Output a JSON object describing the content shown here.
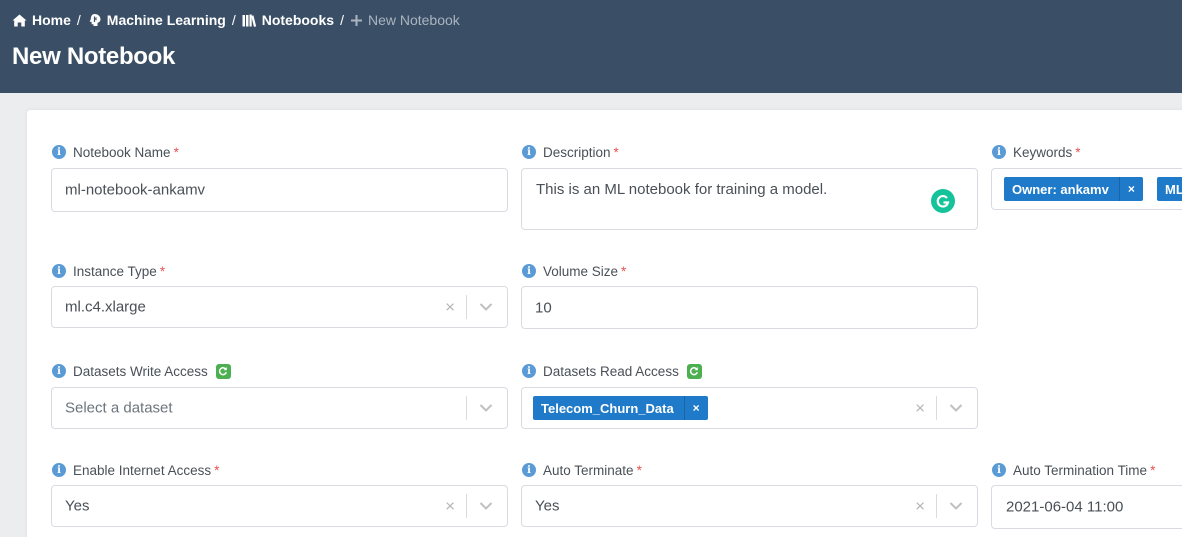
{
  "breadcrumb": {
    "home": "Home",
    "sep1": "/",
    "machine_learning": "Machine Learning",
    "sep2": "/",
    "notebooks": "Notebooks",
    "sep3": "/",
    "current": "New Notebook"
  },
  "page": {
    "title": "New Notebook"
  },
  "form": {
    "notebook_name": {
      "label": "Notebook Name",
      "required": "*",
      "value": "ml-notebook-ankamv"
    },
    "description": {
      "label": "Description",
      "required": "*",
      "value": "This is an ML notebook for training a model."
    },
    "keywords": {
      "label": "Keywords",
      "required": "*",
      "tags": [
        "Owner: ankamv",
        "ML"
      ],
      "remove": "×"
    },
    "instance_type": {
      "label": "Instance Type",
      "required": "*",
      "value": "ml.c4.xlarge"
    },
    "volume_size": {
      "label": "Volume Size",
      "required": "*",
      "value": "10"
    },
    "datasets_write": {
      "label": "Datasets Write Access",
      "placeholder": "Select a dataset"
    },
    "datasets_read": {
      "label": "Datasets Read Access",
      "tags": [
        "Telecom_Churn_Data"
      ],
      "remove": "×"
    },
    "enable_internet": {
      "label": "Enable Internet Access",
      "required": "*",
      "value": "Yes"
    },
    "auto_terminate": {
      "label": "Auto Terminate",
      "required": "*",
      "value": "Yes"
    },
    "auto_termination_time": {
      "label": "Auto Termination Time",
      "required": "*",
      "value": "2021-06-04 11:00"
    }
  },
  "icons": {
    "info": "i",
    "clear": "×",
    "home": "home-icon",
    "brain": "brain-icon",
    "books": "books-icon",
    "plus": "plus-icon",
    "refresh": "refresh-icon",
    "chevron": "chevron-down-icon",
    "grammarly": "grammarly-icon"
  },
  "colors": {
    "header": "#3a4f66",
    "tag": "#1f7bc9",
    "info": "#5b9bd5",
    "required": "#e55353",
    "refresh": "#4caf50",
    "grammarly": "#15c39a"
  }
}
